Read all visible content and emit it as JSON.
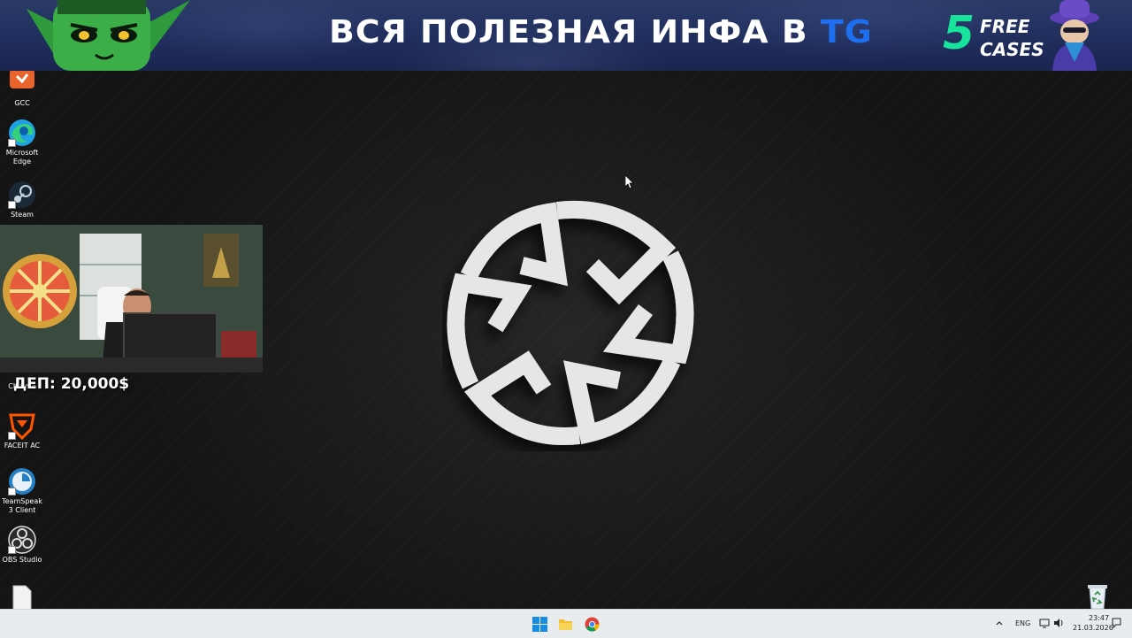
{
  "banner": {
    "headline_prefix": "ВСЯ ПОЛЕЗНАЯ ИНФА В ",
    "headline_accent": "TG",
    "promo_number": "5",
    "promo_line1": "FREE",
    "promo_line2": "CASES",
    "accent_color": "#1e6ff0",
    "promo_color": "#17e39b"
  },
  "desktop": {
    "icons": [
      {
        "label": "GCC",
        "icon": "gcc-icon"
      },
      {
        "label": "Microsoft Edge",
        "icon": "edge-icon"
      },
      {
        "label": "Steam",
        "icon": "steam-icon"
      },
      {
        "label": "Chrome",
        "icon": "chrome-icon"
      },
      {
        "label": "FACEIT AC",
        "icon": "faceit-icon"
      },
      {
        "label": "TeamSpeak 3 Client",
        "icon": "teamspeak-icon"
      },
      {
        "label": "OBS Studio",
        "icon": "obs-icon"
      },
      {
        "label": "",
        "icon": "file-icon"
      }
    ],
    "recycle_bin_icon": "recycle-bin-icon",
    "wallpaper_logo": "circular-logo"
  },
  "stream_overlay": {
    "deposit_label": "ДЕП: 20,000$"
  },
  "taskbar": {
    "pinned": [
      "start-icon",
      "file-explorer-icon",
      "chrome-icon"
    ],
    "tray": {
      "language": "ENG",
      "time": "23:47",
      "date": "21.03.2026"
    }
  }
}
